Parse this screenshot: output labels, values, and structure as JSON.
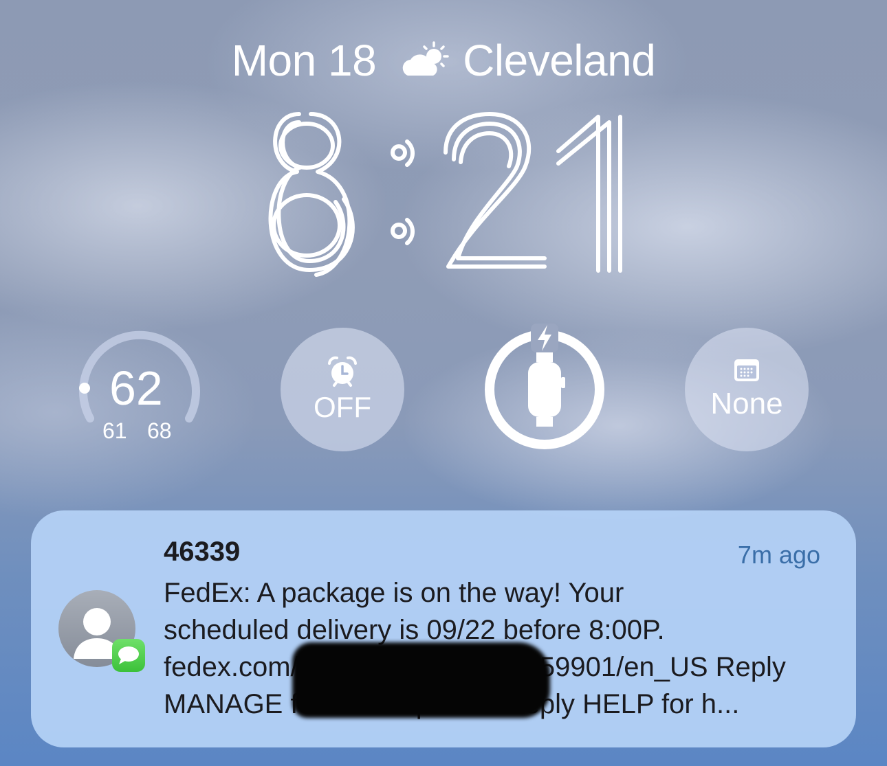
{
  "lockscreen": {
    "date": "Mon 18",
    "location": "Cleveland",
    "weather_icon": "partly-sunny-icon"
  },
  "clock": {
    "time": "8:21"
  },
  "widgets": {
    "temperature": {
      "current": "62",
      "low": "61",
      "high": "68"
    },
    "alarm": {
      "icon": "alarm-clock-icon",
      "label": "OFF"
    },
    "watch_battery": {
      "icon": "apple-watch-icon",
      "charging": true,
      "level": 1.0
    },
    "calendar": {
      "icon": "calendar-icon",
      "label": "None"
    }
  },
  "notification": {
    "sender": "46339",
    "time": "7m ago",
    "app_icon": "messages-icon",
    "lines": [
      "FedEx: A package is on the way! Your",
      "scheduled delivery is 09/22 before 8:00P.",
      "fedex.com/t/",
      "995159901/en_US Reply",
      "MANAGE for more options. Reply HELP for h..."
    ]
  },
  "colors": {
    "notification_bg": "#b5d2f6",
    "message_green": "#3cc13a",
    "time_ago": "#3a6ea8"
  }
}
